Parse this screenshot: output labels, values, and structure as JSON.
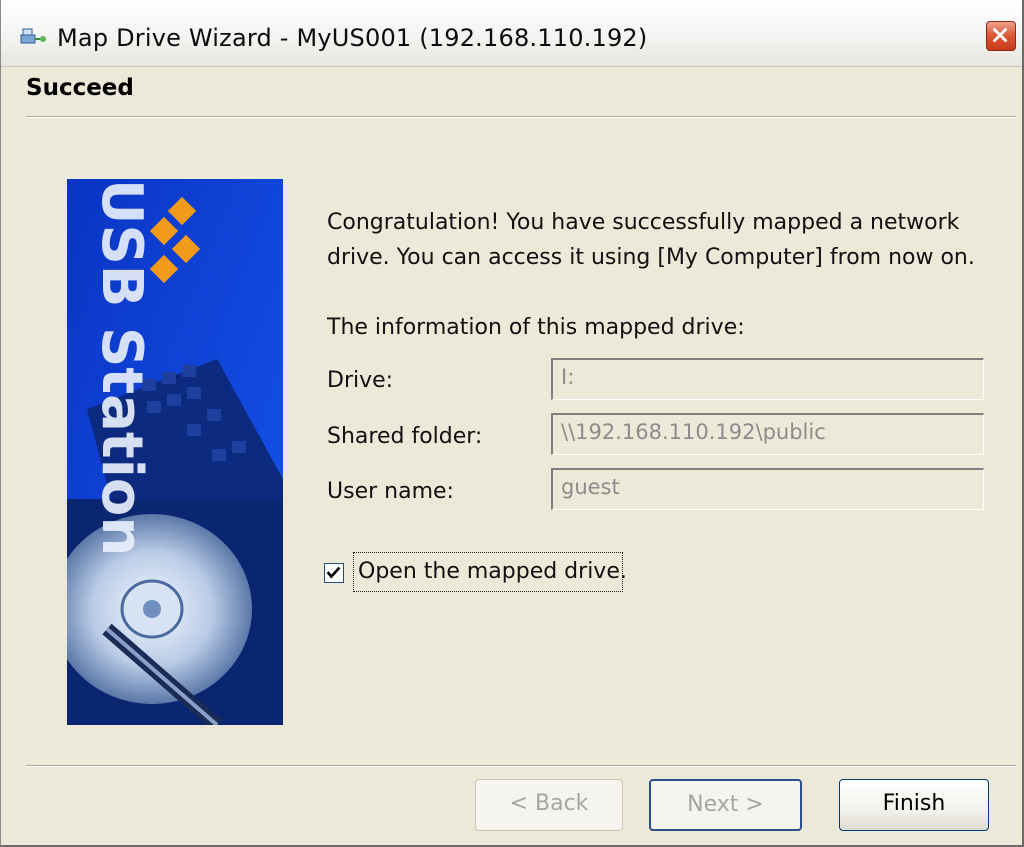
{
  "window": {
    "title": "Map Drive Wizard - MyUS001 (192.168.110.192)",
    "close_label": "×"
  },
  "header": {
    "title": "Succeed"
  },
  "banner": {
    "brand_text": "USB Station"
  },
  "main": {
    "message": "Congratulation! You have successfully mapped a network drive. You can access it using [My Computer] from now on.",
    "info_label": "The information of this mapped drive:",
    "fields": [
      {
        "label": "Drive:",
        "value": "I:"
      },
      {
        "label": "Shared folder:",
        "value": "\\\\192.168.110.192\\public"
      },
      {
        "label": "User name:",
        "value": "guest"
      }
    ],
    "open_drive": {
      "label": "Open the mapped drive.",
      "checked": true
    }
  },
  "buttons": {
    "back": "< Back",
    "next": "Next >",
    "finish": "Finish"
  },
  "colors": {
    "banner_blue": "#0a3fd6",
    "accent_orange": "#f29a1a",
    "close_red": "#dd5a3b"
  },
  "icons": {
    "title_icon": "network-drive-icon",
    "close_icon": "close-icon",
    "check_icon": "checkmark-icon"
  }
}
